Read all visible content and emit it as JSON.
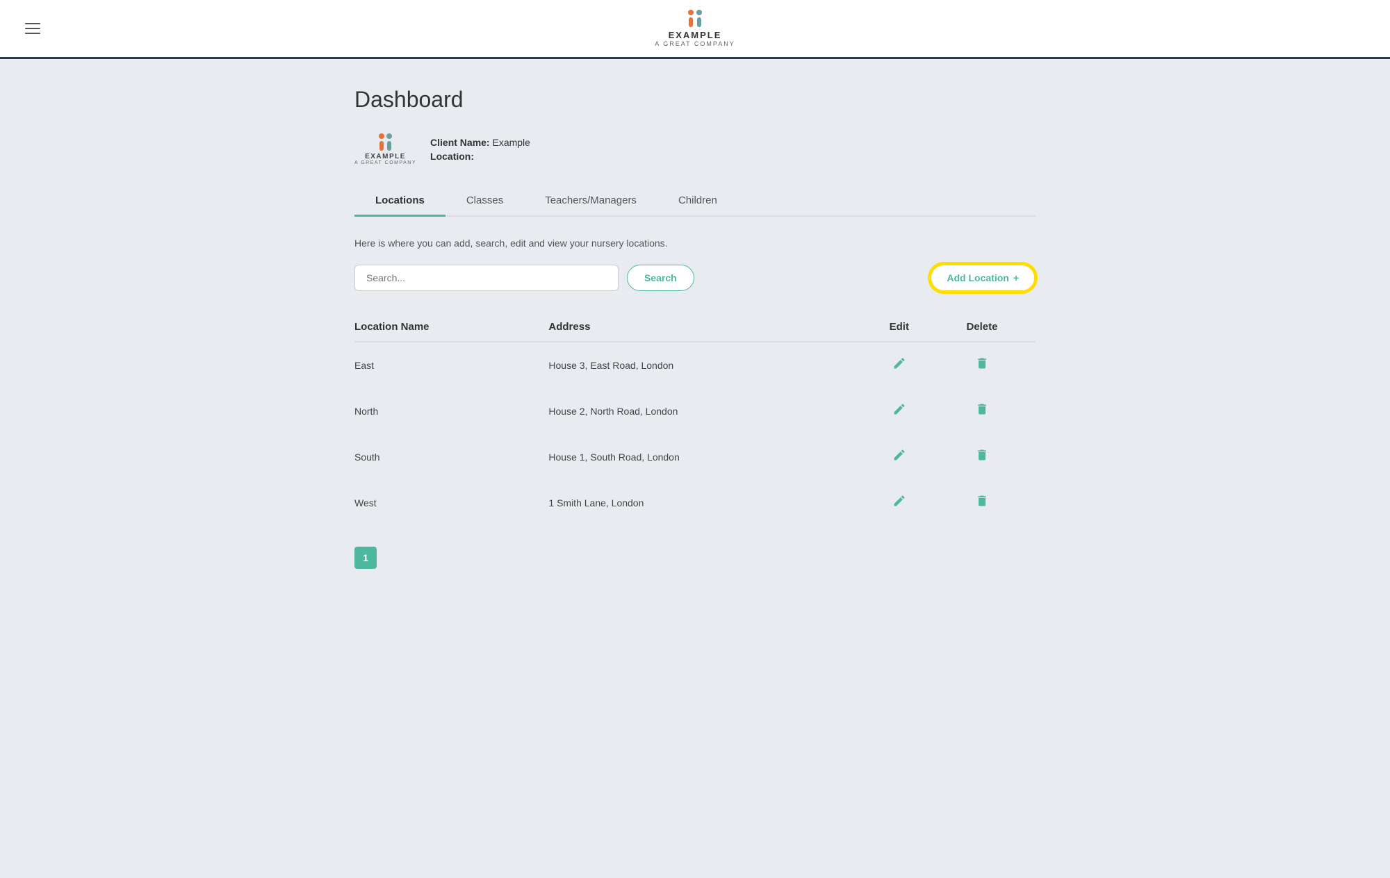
{
  "header": {
    "logo_main": "EXAMPLE",
    "logo_sub": "A GREAT COMPANY",
    "hamburger_label": "Menu"
  },
  "page": {
    "title": "Dashboard",
    "client_label": "Client Name:",
    "client_name": "Example",
    "location_label": "Location:"
  },
  "tabs": [
    {
      "id": "locations",
      "label": "Locations",
      "active": true
    },
    {
      "id": "classes",
      "label": "Classes",
      "active": false
    },
    {
      "id": "teachers",
      "label": "Teachers/Managers",
      "active": false
    },
    {
      "id": "children",
      "label": "Children",
      "active": false
    }
  ],
  "content": {
    "description": "Here is where you can add, search, edit and view your nursery locations.",
    "search_placeholder": "Search...",
    "search_button": "Search",
    "add_button": "Add Location",
    "add_button_icon": "+"
  },
  "table": {
    "headers": {
      "name": "Location Name",
      "address": "Address",
      "edit": "Edit",
      "delete": "Delete"
    },
    "rows": [
      {
        "name": "East",
        "address": "House 3, East Road, London"
      },
      {
        "name": "North",
        "address": "House 2, North Road, London"
      },
      {
        "name": "South",
        "address": "House 1, South Road, London"
      },
      {
        "name": "West",
        "address": "1 Smith Lane, London"
      }
    ]
  },
  "pagination": {
    "current_page": "1"
  }
}
